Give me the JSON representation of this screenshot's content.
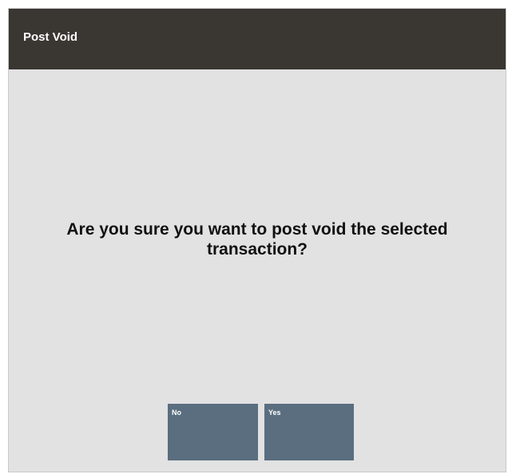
{
  "dialog": {
    "title": "Post Void",
    "message": "Are you sure you want to post void the selected transaction?"
  },
  "buttons": {
    "no_label": "No",
    "yes_label": "Yes"
  },
  "colors": {
    "titlebar": "#3a3632",
    "background": "#e2e2e2",
    "button": "#5a6e80"
  }
}
